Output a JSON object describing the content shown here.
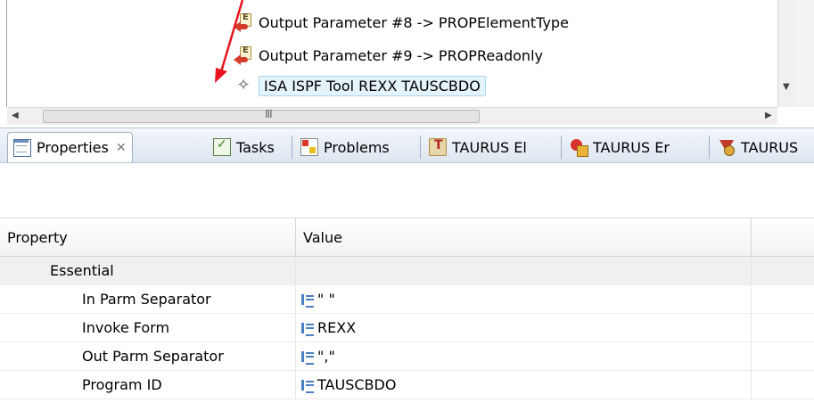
{
  "tree": {
    "items": [
      {
        "label": "Output Parameter #8 -> PROPElementType",
        "icon": "output-parameter-icon"
      },
      {
        "label": "Output Parameter #9 -> PROPReadonly",
        "icon": "output-parameter-icon"
      },
      {
        "label": "ISA ISPF Tool REXX TAUSCBDO",
        "icon": "tool-diamond-icon",
        "selected": true
      }
    ],
    "hscroll_grip": "III"
  },
  "tabs": [
    {
      "label": "Properties",
      "icon": "properties-icon",
      "active": true,
      "close": "✕"
    },
    {
      "label": "Tasks",
      "icon": "tasks-icon"
    },
    {
      "label": "Problems",
      "icon": "problems-icon"
    },
    {
      "label": "TAURUS El",
      "icon": "taurus-element-icon"
    },
    {
      "label": "TAURUS Er",
      "icon": "taurus-error-icon"
    },
    {
      "label": "TAURUS",
      "icon": "taurus-icon"
    }
  ],
  "properties": {
    "columns": [
      "Property",
      "Value"
    ],
    "category": "Essential",
    "rows": [
      {
        "property": "In Parm Separator",
        "value": "\" \""
      },
      {
        "property": "Invoke Form",
        "value": "REXX"
      },
      {
        "property": "Out Parm Separator",
        "value": "\",\""
      },
      {
        "property": "Program ID",
        "value": "TAUSCBDO"
      }
    ]
  },
  "colors": {
    "selection_fill": "#e5f3fb",
    "annotation_arrow": "#e8141e",
    "tab_bar": "#dde6f0"
  }
}
